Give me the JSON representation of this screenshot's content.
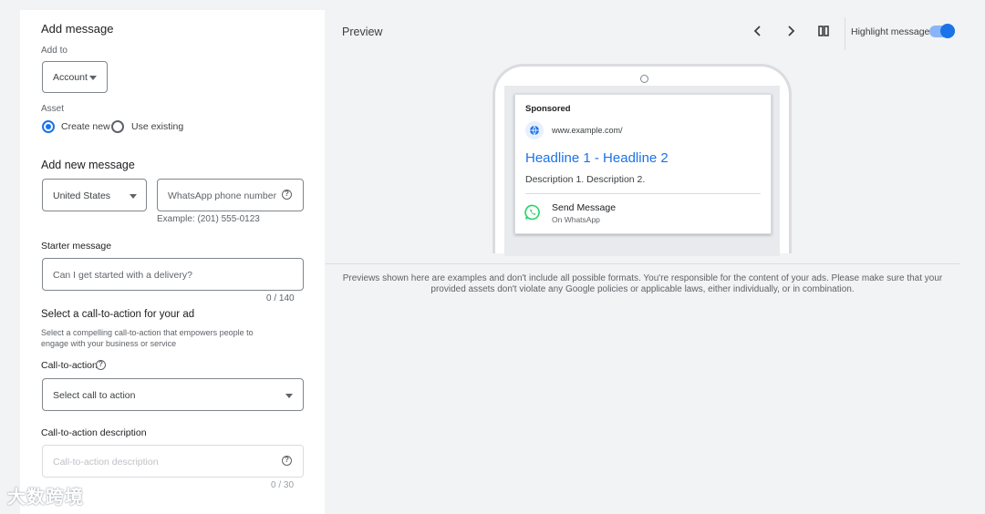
{
  "left": {
    "add_message_title": "Add message",
    "add_to_label": "Add to",
    "add_to_value": "Account",
    "asset_label": "Asset",
    "asset_options": {
      "create_new": "Create new",
      "use_existing": "Use existing"
    },
    "add_new_message_title": "Add new message",
    "country_value": "United States",
    "phone_placeholder": "WhatsApp phone number",
    "phone_example": "Example: (201) 555-0123",
    "starter_message_label": "Starter message",
    "starter_message_placeholder": "Can I get started with a delivery?",
    "starter_message_counter": "0 / 140",
    "cta_section_title": "Select a call-to-action for your ad",
    "cta_section_desc_line1": "Select a compelling call-to-action that empowers people to",
    "cta_section_desc_line2": "engage with your business or service",
    "cta_label": "Call-to-action",
    "cta_select_value": "Select call to action",
    "cta_desc_label": "Call-to-action description",
    "cta_desc_placeholder": "Call-to-action description",
    "cta_desc_counter": "0 / 30"
  },
  "preview": {
    "title": "Preview",
    "highlight_label": "Highlight message",
    "highlight_on": true,
    "ad": {
      "sponsored": "Sponsored",
      "url": "www.example.com/",
      "headline": "Headline 1 - Headline 2",
      "description": "Description 1. Description 2.",
      "cta": "Send Message",
      "cta_sub": "On WhatsApp"
    },
    "disclaimer": "Previews shown here are examples and don't include all possible formats. You're responsible for the content of your ads. Please make sure that your provided assets don't violate any Google policies or applicable laws, either individually, or in combination."
  },
  "colors": {
    "accent": "#1a73e8",
    "headline": "#1a73e8",
    "whatsapp": "#25d366"
  },
  "watermark": "大数跨境"
}
